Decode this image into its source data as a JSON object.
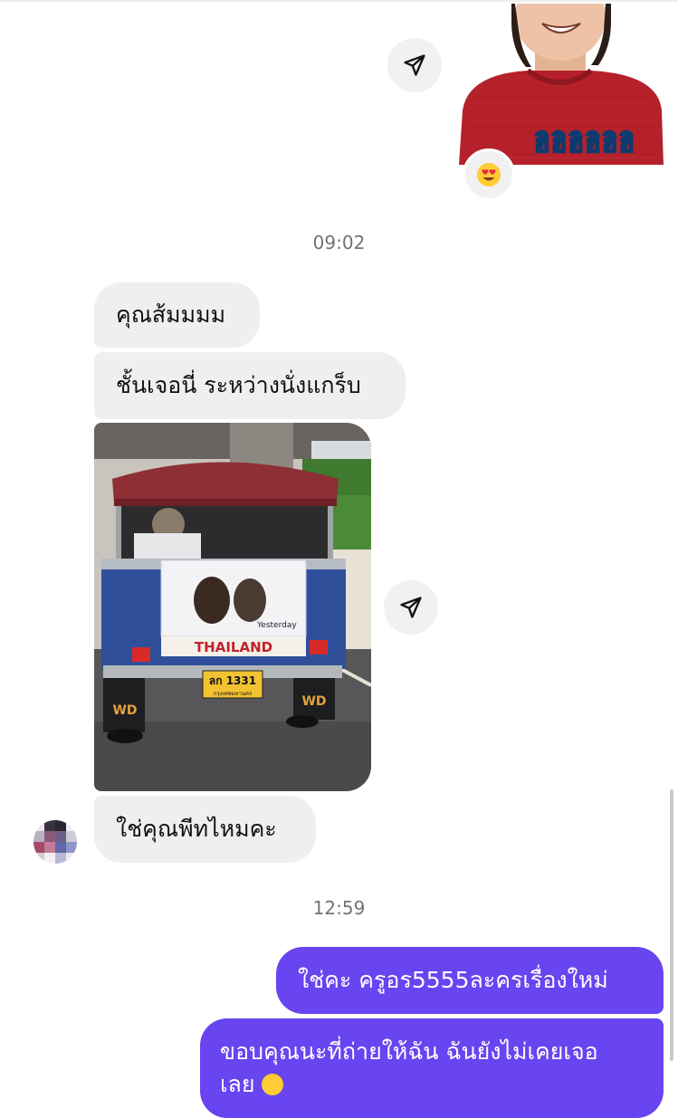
{
  "thread": {
    "sticker_caption": "ฮิฮิฮิฮิฮิฮิ",
    "sticker_reaction_icon": "heart-eyes-emoji",
    "timestamp_1": "09:02",
    "timestamp_2": "12:59"
  },
  "messages": {
    "m1": "คุณส้มมมม",
    "m2": "ชั้นเจอนี่ ระหว่างนั่งแกร็บ",
    "photo_sign_brand": "THAILAND",
    "photo_plate_number": "ลก 1331",
    "photo_plate_province": "กรุงเทพมหานคร",
    "photo_poster_text": "Yesterday",
    "m3": "ใช่คุณพีทไหมคะ",
    "m4": "ใช่คะ ครูอร5555ละครเรื่องใหม่",
    "m5_line1": "ขอบคุณนะที่ถ่ายให้ฉัน ฉันยังไม่เคยเจอ",
    "m5_line2": "เลย"
  },
  "colors": {
    "outgoing_bubble": "#6845f0",
    "incoming_bubble": "#efefef",
    "timestamp": "#737373"
  },
  "icons": {
    "share": "paper-plane-icon"
  }
}
